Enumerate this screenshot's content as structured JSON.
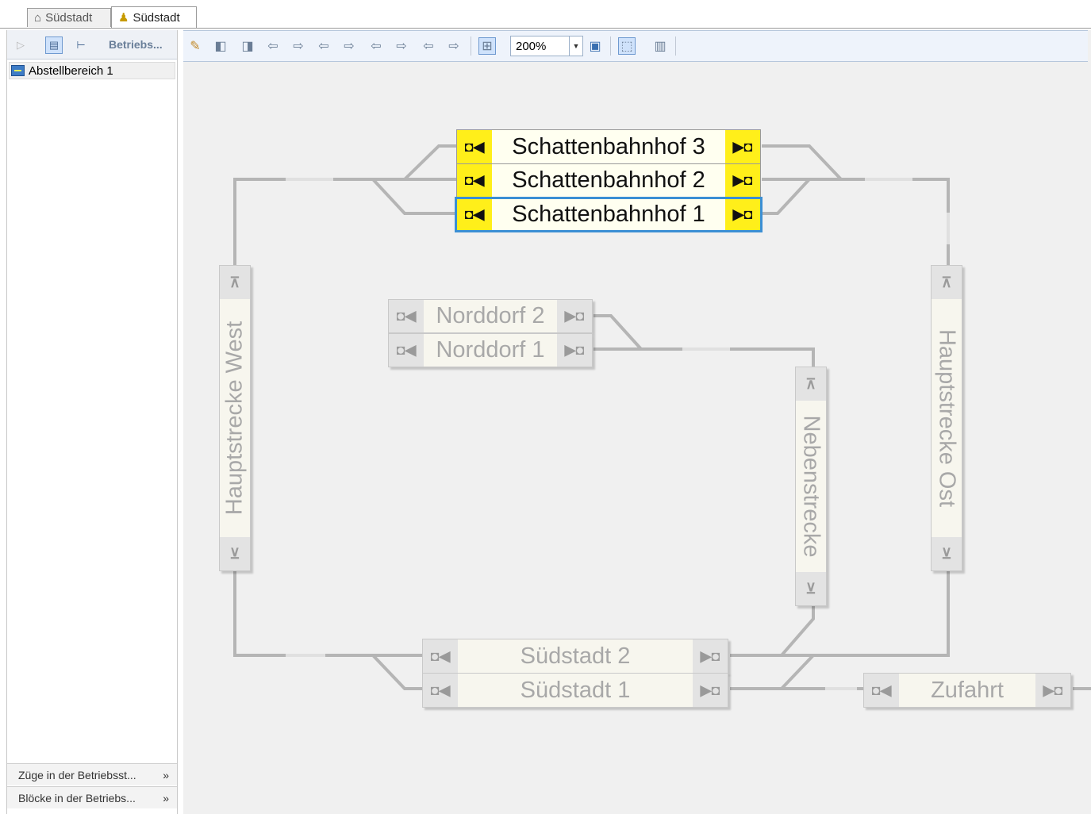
{
  "document_tabs": [
    {
      "label": "Südstadt",
      "icon": "signal-box-icon",
      "active": false
    },
    {
      "label": "Südstadt",
      "icon": "operation-point-icon",
      "active": true
    }
  ],
  "left_panel": {
    "toolbar_label": "Betriebs...",
    "tree_items": [
      {
        "label": "Abstellbereich 1",
        "icon": "siding-icon"
      }
    ],
    "bottom_panes": [
      {
        "label": "Züge in der Betriebsst...",
        "icon": "expand-double-chevron-icon"
      },
      {
        "label": "Blöcke in der Betriebs...",
        "icon": "expand-double-chevron-icon"
      }
    ]
  },
  "toolbar": {
    "zoom_value": "200%",
    "icons": [
      "edit-train-icon",
      "block-left-icon",
      "block-right-icon",
      "arrow-left-icon",
      "arrow-right-icon",
      "arrow-left-icon",
      "arrow-right-icon",
      "arrow-left-icon",
      "arrow-right-icon",
      "arrow-left-icon",
      "arrow-right-icon",
      "layout-icon",
      "fit-window-icon",
      "select-tool-icon",
      "train-icon"
    ]
  },
  "blocks": {
    "schattenbahnhof_3": "Schattenbahnhof 3",
    "schattenbahnhof_2": "Schattenbahnhof 2",
    "schattenbahnhof_1": "Schattenbahnhof 1",
    "norddorf_2": "Norddorf 2",
    "norddorf_1": "Norddorf 1",
    "hauptstrecke_west": "Hauptstrecke West",
    "hauptstrecke_ost": "Hauptstrecke Ost",
    "nebenstrecke": "Nebenstrecke",
    "suedstadt_2": "Südstadt 2",
    "suedstadt_1": "Südstadt 1",
    "zufahrt": "Zufahrt"
  },
  "colors": {
    "selection": "#3b8fd4",
    "highlight_terminal": "#ffef1a",
    "track": "#b5b5b5"
  }
}
